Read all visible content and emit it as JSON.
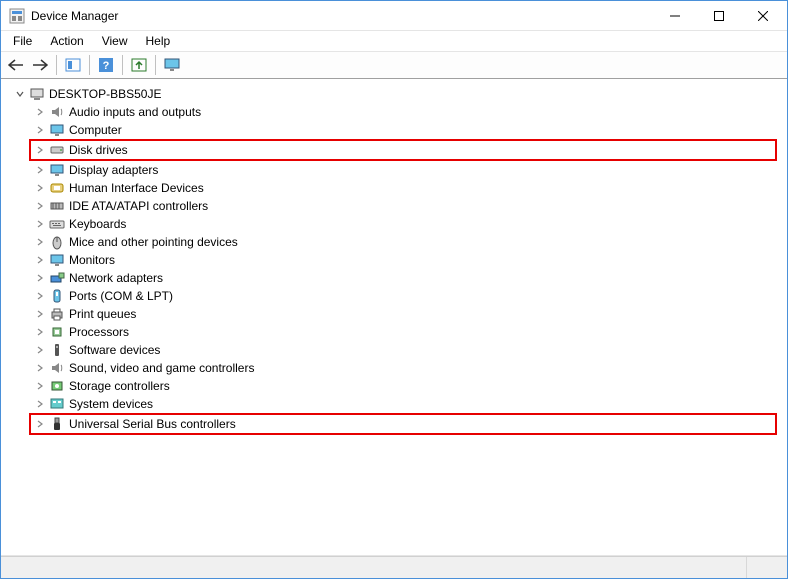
{
  "window": {
    "title": "Device Manager"
  },
  "menu": {
    "items": [
      "File",
      "Action",
      "View",
      "Help"
    ]
  },
  "tree": {
    "root": {
      "label": "DESKTOP-BBS50JE",
      "expanded": true
    },
    "children": [
      {
        "label": "Audio inputs and outputs",
        "icon": "speaker",
        "highlight": false
      },
      {
        "label": "Computer",
        "icon": "monitor",
        "highlight": false
      },
      {
        "label": "Disk drives",
        "icon": "drive",
        "highlight": true
      },
      {
        "label": "Display adapters",
        "icon": "monitor",
        "highlight": false
      },
      {
        "label": "Human Interface Devices",
        "icon": "hid",
        "highlight": false
      },
      {
        "label": "IDE ATA/ATAPI controllers",
        "icon": "ide",
        "highlight": false
      },
      {
        "label": "Keyboards",
        "icon": "keyboard",
        "highlight": false
      },
      {
        "label": "Mice and other pointing devices",
        "icon": "mouse",
        "highlight": false
      },
      {
        "label": "Monitors",
        "icon": "monitor",
        "highlight": false
      },
      {
        "label": "Network adapters",
        "icon": "network",
        "highlight": false
      },
      {
        "label": "Ports (COM & LPT)",
        "icon": "port",
        "highlight": false
      },
      {
        "label": "Print queues",
        "icon": "printer",
        "highlight": false
      },
      {
        "label": "Processors",
        "icon": "cpu",
        "highlight": false
      },
      {
        "label": "Software devices",
        "icon": "soft",
        "highlight": false
      },
      {
        "label": "Sound, video and game controllers",
        "icon": "speaker",
        "highlight": false
      },
      {
        "label": "Storage controllers",
        "icon": "storage",
        "highlight": false
      },
      {
        "label": "System devices",
        "icon": "system",
        "highlight": false
      },
      {
        "label": "Universal Serial Bus controllers",
        "icon": "usb",
        "highlight": true
      }
    ]
  }
}
